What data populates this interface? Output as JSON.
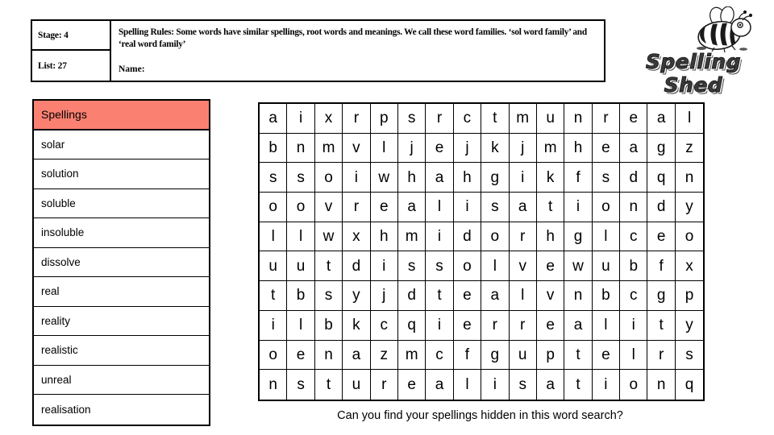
{
  "header": {
    "stage_label": "Stage: 4",
    "list_label": "List: 27",
    "rules_text": "Spelling Rules: Some words have similar spellings, root words and meanings. We call these word families. ‘sol word family’ and ‘real word family’",
    "name_label": "Name:"
  },
  "logo": {
    "wordmark": "Spelling Shed",
    "bee_icon": "bee-icon"
  },
  "spellings": {
    "header": "Spellings",
    "header_color": "#fa8072",
    "words": [
      "solar",
      "solution",
      "soluble",
      "insoluble",
      "dissolve",
      "real",
      "reality",
      "realistic",
      "unreal",
      "realisation"
    ]
  },
  "wordsearch": {
    "rows": 10,
    "cols": 16,
    "grid": [
      [
        "a",
        "i",
        "x",
        "r",
        "p",
        "s",
        "r",
        "c",
        "t",
        "m",
        "u",
        "n",
        "r",
        "e",
        "a",
        "l"
      ],
      [
        "b",
        "n",
        "m",
        "v",
        "l",
        "j",
        "e",
        "j",
        "k",
        "j",
        "m",
        "h",
        "e",
        "a",
        "g",
        "z"
      ],
      [
        "s",
        "s",
        "o",
        "i",
        "w",
        "h",
        "a",
        "h",
        "g",
        "i",
        "k",
        "f",
        "s",
        "d",
        "q",
        "n"
      ],
      [
        "o",
        "o",
        "v",
        "r",
        "e",
        "a",
        "l",
        "i",
        "s",
        "a",
        "t",
        "i",
        "o",
        "n",
        "d",
        "y"
      ],
      [
        "l",
        "l",
        "w",
        "x",
        "h",
        "m",
        "i",
        "d",
        "o",
        "r",
        "h",
        "g",
        "l",
        "c",
        "e",
        "o"
      ],
      [
        "u",
        "u",
        "t",
        "d",
        "i",
        "s",
        "s",
        "o",
        "l",
        "v",
        "e",
        "w",
        "u",
        "b",
        "f",
        "x"
      ],
      [
        "t",
        "b",
        "s",
        "y",
        "j",
        "d",
        "t",
        "e",
        "a",
        "l",
        "v",
        "n",
        "b",
        "c",
        "g",
        "p"
      ],
      [
        "i",
        "l",
        "b",
        "k",
        "c",
        "q",
        "i",
        "e",
        "r",
        "r",
        "e",
        "a",
        "l",
        "i",
        "t",
        "y"
      ],
      [
        "o",
        "e",
        "n",
        "a",
        "z",
        "m",
        "c",
        "f",
        "g",
        "u",
        "p",
        "t",
        "e",
        "l",
        "r",
        "s"
      ],
      [
        "n",
        "s",
        "t",
        "u",
        "r",
        "e",
        "a",
        "l",
        "i",
        "s",
        "a",
        "t",
        "i",
        "o",
        "n",
        "q"
      ]
    ]
  },
  "caption": "Can you find your spellings hidden in this word search?"
}
